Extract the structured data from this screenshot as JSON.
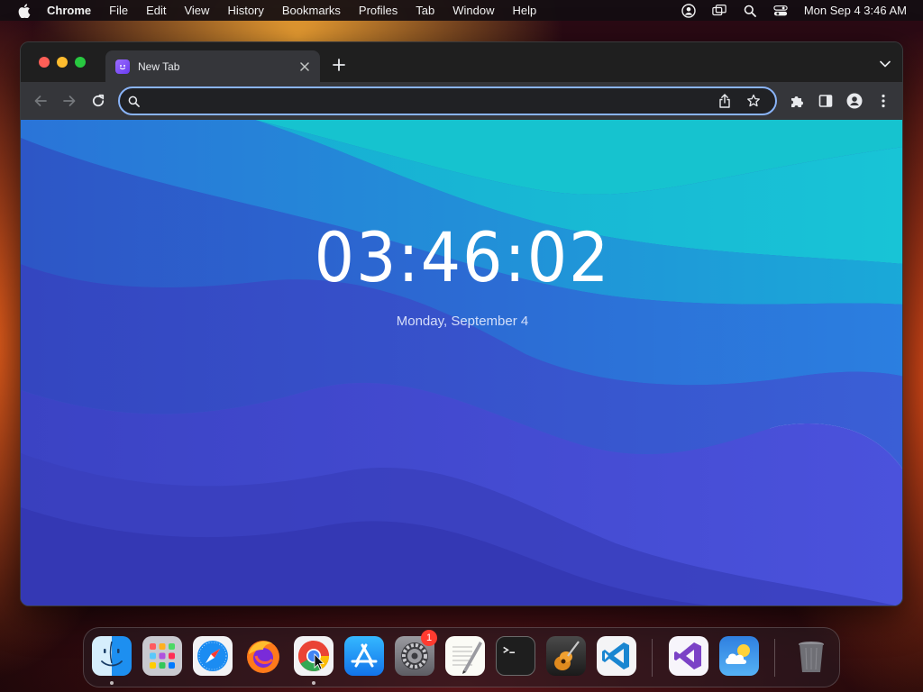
{
  "menubar": {
    "app_name": "Chrome",
    "items": [
      "File",
      "Edit",
      "View",
      "History",
      "Bookmarks",
      "Profiles",
      "Tab",
      "Window",
      "Help"
    ],
    "status_icons": [
      "user-switch-icon",
      "screen-mirroring-icon",
      "spotlight-search-icon",
      "control-center-icon"
    ],
    "clock": "Mon Sep 4  3:46 AM"
  },
  "browser": {
    "tab": {
      "title": "New Tab",
      "favicon": "new-tab-extension-icon"
    },
    "omnibox": {
      "value": "",
      "placeholder": ""
    },
    "accent_color": "#8ab4f8"
  },
  "page": {
    "time": "03:46:02",
    "date": "Monday, September 4"
  },
  "dock": {
    "apps": [
      {
        "name": "Finder",
        "icon": "finder-icon",
        "running": true
      },
      {
        "name": "Launchpad",
        "icon": "launchpad-icon",
        "running": false
      },
      {
        "name": "Safari",
        "icon": "safari-icon",
        "running": false
      },
      {
        "name": "Firefox",
        "icon": "firefox-icon",
        "running": false
      },
      {
        "name": "Google Chrome",
        "icon": "chrome-icon",
        "running": true
      },
      {
        "name": "App Store",
        "icon": "app-store-icon",
        "running": false
      },
      {
        "name": "System Settings",
        "icon": "system-settings-icon",
        "running": false,
        "badge": "1"
      },
      {
        "name": "TextEdit",
        "icon": "textedit-icon",
        "running": false
      },
      {
        "name": "Terminal",
        "icon": "terminal-icon",
        "running": false
      },
      {
        "name": "GarageBand",
        "icon": "garageband-icon",
        "running": false
      },
      {
        "name": "Visual Studio Code",
        "icon": "vscode-icon",
        "running": false
      },
      {
        "name": "Visual Studio",
        "icon": "visual-studio-icon",
        "running": false
      },
      {
        "name": "Weather",
        "icon": "weather-icon",
        "running": false
      },
      {
        "name": "Trash",
        "icon": "trash-icon",
        "running": false
      }
    ]
  }
}
